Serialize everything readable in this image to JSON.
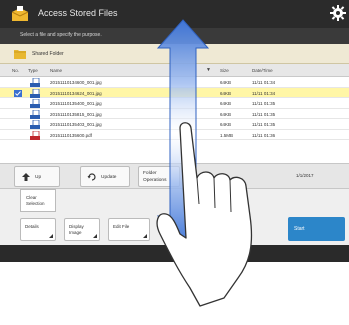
{
  "window": {
    "title": "Access Stored Files",
    "subtitle": "Select a file and specify the purpose."
  },
  "folder": {
    "name": "Shared Folder"
  },
  "columns": {
    "num": "No.",
    "type": "Type",
    "name": "Name",
    "sort_indicator": "▼",
    "size": "Size",
    "date": "Date/Time"
  },
  "files": [
    {
      "name": "20151110134600_001.jpg",
      "size": "64KB",
      "date": "11/11 01:34",
      "selected": false
    },
    {
      "name": "20151110134624_001.jpg",
      "size": "64KB",
      "date": "11/11 01:34",
      "selected": true
    },
    {
      "name": "20151110135400_001.jpg",
      "size": "64KB",
      "date": "11/11 01:35",
      "selected": false
    },
    {
      "name": "20151110135815_001.jpg",
      "size": "64KB",
      "date": "11/11 01:35",
      "selected": false
    },
    {
      "name": "20151110135403_001.jpg",
      "size": "64KB",
      "date": "11/11 01:35",
      "selected": false
    },
    {
      "name": "20151110135600.pdf",
      "size": "1.5MB",
      "date": "11/11 01:36",
      "selected": false
    }
  ],
  "toolbar": {
    "up_label": "Up",
    "update_label": "Update",
    "folder_ops_label_1": "Folder",
    "folder_ops_label_2": "Operations",
    "page_counter": "1/1/2017"
  },
  "options": {
    "clear_label_1": "Clear",
    "clear_label_2": "Selection"
  },
  "bottom": {
    "details_label": "Details",
    "display_image_label_1": "Display",
    "display_image_label_2": "Image",
    "edit_file_label": "Edit File",
    "start_label": "Start"
  },
  "colors": {
    "title_bar": "#2b2b2b",
    "selected_row": "#fff6a6",
    "scroll_arrow": "#3e74d6",
    "start_button": "#2c86c9"
  },
  "icons": {
    "app": "file-box-icon",
    "gear": "gear-icon",
    "folder": "folder-icon",
    "file": "file-icon",
    "up": "up-arrow-icon",
    "update": "refresh-icon",
    "scroll": "vertical-scroll-arrow-icon",
    "hand": "hand-gesture-icon"
  }
}
